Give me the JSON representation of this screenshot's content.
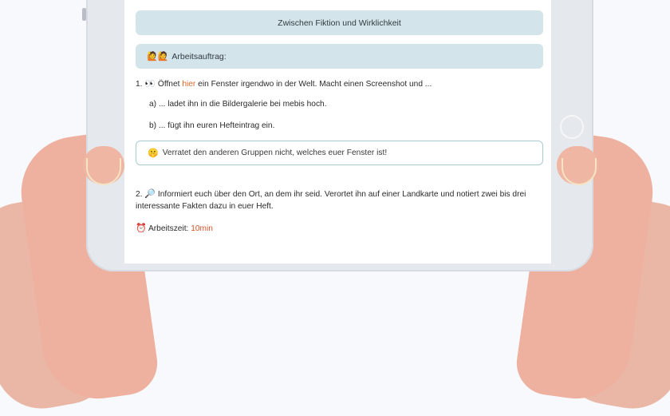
{
  "page": {
    "title": "Zwischen Fiktion und Wirklichkeit",
    "task_header": {
      "icons": "🙋🙋",
      "label": "Arbeitsauftrag:"
    },
    "items": {
      "one": {
        "number": "1.",
        "icon": "👀",
        "text_before": "Öffnet",
        "link": "hier",
        "text_after": "ein Fenster irgendwo in der Welt. Macht einen Screenshot und ..."
      },
      "a": "a) ... ladet ihn in die Bildergalerie bei mebis hoch.",
      "b": "b) ... fügt ihn euren Hefteintrag ein.",
      "note": {
        "icon": "🤫",
        "text": "Verratet den anderen Gruppen nicht, welches euer Fenster ist!"
      },
      "two": {
        "number": "2.",
        "icon": "🔎",
        "line1": "Informiert euch über den Ort, an dem ihr seid. Verortet ihn auf einer Landkarte und notiert zwei bis drei",
        "line2": "interessante Fakten dazu in euer Heft."
      },
      "time": {
        "icon": "⏰",
        "label": "Arbeitszeit:",
        "value": "10min"
      }
    }
  },
  "colors": {
    "accent": "#d9682a",
    "banner": "#d3e5ea",
    "note_border": "#a9ccd4"
  }
}
